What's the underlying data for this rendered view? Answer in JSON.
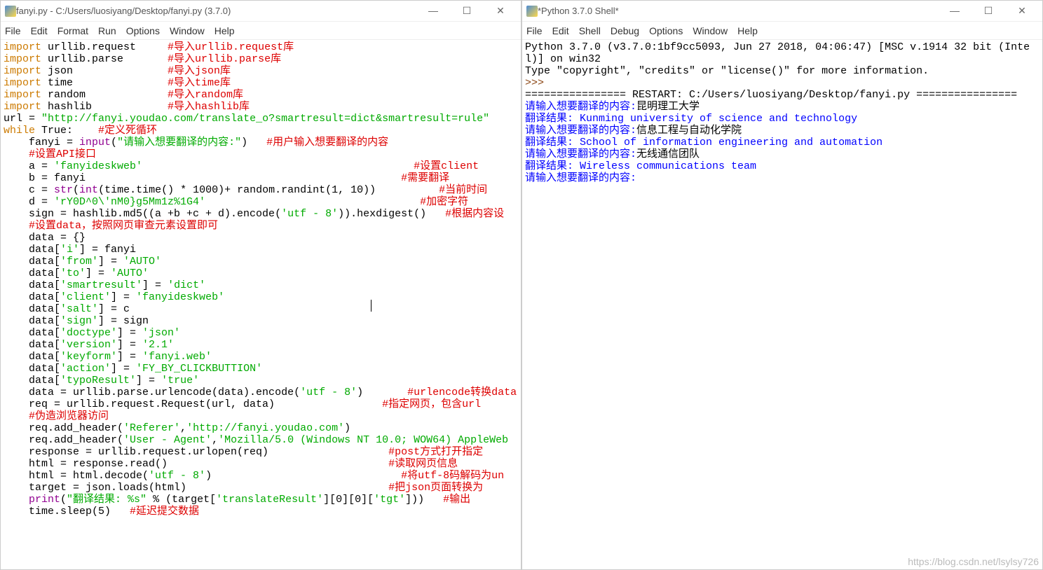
{
  "editor": {
    "title": "fanyi.py - C:/Users/luosiyang/Desktop/fanyi.py (3.7.0)",
    "menu": [
      "File",
      "Edit",
      "Format",
      "Run",
      "Options",
      "Window",
      "Help"
    ],
    "win_min": "—",
    "win_max": "☐",
    "win_close": "✕"
  },
  "shell": {
    "title": "*Python 3.7.0 Shell*",
    "menu": [
      "File",
      "Edit",
      "Shell",
      "Debug",
      "Options",
      "Window",
      "Help"
    ],
    "win_min": "—",
    "win_max": "☐",
    "win_close": "✕",
    "banner1": "Python 3.7.0 (v3.7.0:1bf9cc5093, Jun 27 2018, 04:06:47) [MSC v.1914 32 bit (Intel)] on win32",
    "banner2": "Type \"copyright\", \"credits\" or \"license()\" for more information.",
    "prompt": ">>>",
    "restart": "================ RESTART: C:/Users/luosiyang/Desktop/fanyi.py ================",
    "in1_label": "请输入想要翻译的内容:",
    "in1_val": "昆明理工大学",
    "out1": "翻译结果: Kunming university of science and technology",
    "in2_label": "请输入想要翻译的内容:",
    "in2_val": "信息工程与自动化学院",
    "out2": "翻译结果: School of information engineering and automation",
    "in3_label": "请输入想要翻译的内容:",
    "in3_val": "无线通信团队",
    "out3": "翻译结果: Wireless communications team",
    "in4_label": "请输入想要翻译的内容:"
  },
  "code": {
    "l01_kw": "import",
    "l01_mod": " urllib.request     ",
    "l01_cmt": "#导入urllib.request库",
    "l02_kw": "import",
    "l02_mod": " urllib.parse       ",
    "l02_cmt": "#导入urllib.parse库",
    "l03_kw": "import",
    "l03_mod": " json               ",
    "l03_cmt": "#导入json库",
    "l04_kw": "import",
    "l04_mod": " time               ",
    "l04_cmt": "#导入time库",
    "l05_kw": "import",
    "l05_mod": " random             ",
    "l05_cmt": "#导入random库",
    "l06_kw": "import",
    "l06_mod": " hashlib            ",
    "l06_cmt": "#导入hashlib库",
    "l07_a": "url = ",
    "l07_s": "\"http://fanyi.youdao.com/translate_o?smartresult=dict&smartresult=rule\"",
    "l08_kw": "while",
    "l08_b": " True:    ",
    "l08_cmt": "#定义死循环",
    "l09_a": "    fanyi = ",
    "l09_b": "input",
    "l09_c": "(",
    "l09_s": "\"请输入想要翻译的内容:\"",
    "l09_d": ")   ",
    "l09_cmt": "#用户输入想要翻译的内容",
    "l10_cmt": "    #设置API接口",
    "l11_a": "    a = ",
    "l11_s": "'fanyideskweb'",
    "l11_sp": "                                           ",
    "l11_cmt": "#设置client",
    "l12_a": "    b = fanyi                                                  ",
    "l12_cmt": "#需要翻译",
    "l13_a": "    c = ",
    "l13_b": "str",
    "l13_c": "(",
    "l13_d": "int",
    "l13_e": "(time.time() * 1000)+ random.randint(1, 10))          ",
    "l13_cmt": "#当前时间",
    "l14_a": "    d = ",
    "l14_s": "'rY0D^0\\'nM0}g5Mm1z%1G4'",
    "l14_sp": "                                  ",
    "l14_cmt": "#加密字符",
    "l15_a": "    sign = hashlib.md5((a +b +c + d).encode(",
    "l15_s": "'utf - 8'",
    "l15_b": ")).hexdigest()   ",
    "l15_cmt": "#根据内容设",
    "l16_cmt": "    #设置data，按照网页审查元素设置即可",
    "l17": "    data = {}",
    "l18_a": "    data[",
    "l18_s": "'i'",
    "l18_b": "] = fanyi",
    "l19_a": "    data[",
    "l19_s": "'from'",
    "l19_b": "] = ",
    "l19_s2": "'AUTO'",
    "l20_a": "    data[",
    "l20_s": "'to'",
    "l20_b": "] = ",
    "l20_s2": "'AUTO'",
    "l21_a": "    data[",
    "l21_s": "'smartresult'",
    "l21_b": "] = ",
    "l21_s2": "'dict'",
    "l22_a": "    data[",
    "l22_s": "'client'",
    "l22_b": "] = ",
    "l22_s2": "'fanyideskweb'",
    "l23_a": "    data[",
    "l23_s": "'salt'",
    "l23_b": "] = c",
    "l24_a": "    data[",
    "l24_s": "'sign'",
    "l24_b": "] = sign",
    "l25_a": "    data[",
    "l25_s": "'doctype'",
    "l25_b": "] = ",
    "l25_s2": "'json'",
    "l26_a": "    data[",
    "l26_s": "'version'",
    "l26_b": "] = ",
    "l26_s2": "'2.1'",
    "l27_a": "    data[",
    "l27_s": "'keyform'",
    "l27_b": "] = ",
    "l27_s2": "'fanyi.web'",
    "l28_a": "    data[",
    "l28_s": "'action'",
    "l28_b": "] = ",
    "l28_s2": "'FY_BY_CLICKBUTTION'",
    "l29_a": "    data[",
    "l29_s": "'typoResult'",
    "l29_b": "] = ",
    "l29_s2": "'true'",
    "l30_a": "    data = urllib.parse.urlencode(data).encode(",
    "l30_s": "'utf - 8'",
    "l30_b": ")       ",
    "l30_cmt": "#urlencode转换data",
    "l31_a": "    req = urllib.request.Request(url, data)                 ",
    "l31_cmt": "#指定网页，包含url",
    "l32_cmt": "    #伪造浏览器访问",
    "l33_a": "    req.add_header(",
    "l33_s1": "'Referer'",
    "l33_b": ",",
    "l33_s2": "'http://fanyi.youdao.com'",
    "l33_c": ")",
    "l34_a": "    req.add_header(",
    "l34_s1": "'User - Agent'",
    "l34_b": ",",
    "l34_s2": "'Mozilla/5.0 (Windows NT 10.0; WOW64) AppleWeb",
    "l35_a": "    response = urllib.request.urlopen(req)                   ",
    "l35_cmt": "#post方式打开指定",
    "l36_a": "    html = response.read()                                   ",
    "l36_cmt": "#读取网页信息",
    "l37_a": "    html = html.decode(",
    "l37_s": "'utf - 8'",
    "l37_b": ")                              ",
    "l37_cmt": "#将utf-8码解码为un",
    "l38_a": "    target = json.loads(html)                                ",
    "l38_cmt": "#把json页面转换为",
    "l39_a": "    ",
    "l39_b": "print",
    "l39_c": "(",
    "l39_s": "\"翻译结果: %s\"",
    "l39_d": " % (target[",
    "l39_s2": "'translateResult'",
    "l39_e": "][0][0][",
    "l39_s3": "'tgt'",
    "l39_f": "]))   ",
    "l39_cmt": "#输出",
    "l40_a": "    time.sleep(5)   ",
    "l40_cmt": "#延迟提交数据"
  },
  "watermark": "https://blog.csdn.net/lsylsy726"
}
